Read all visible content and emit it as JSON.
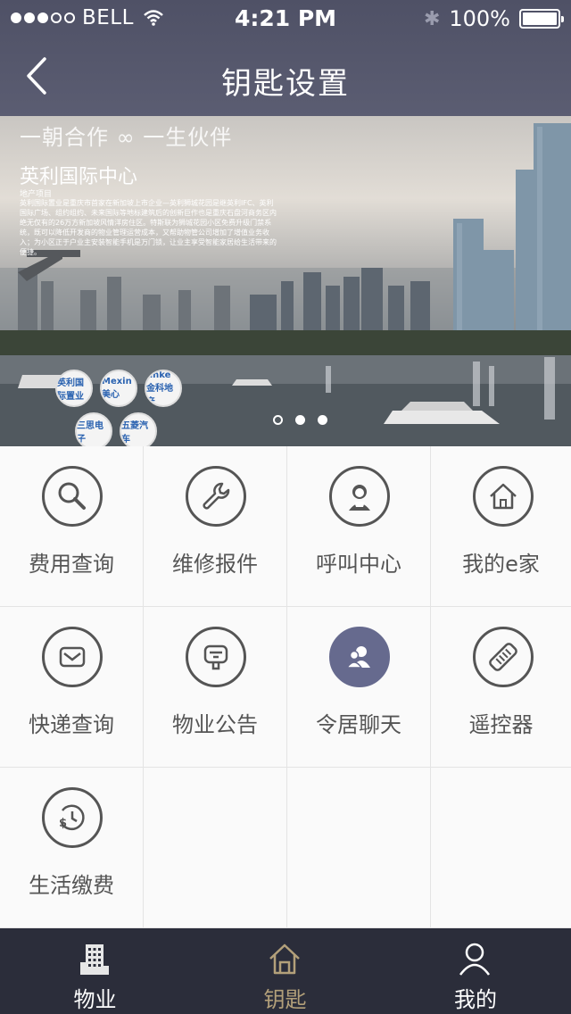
{
  "status_bar": {
    "carrier": "BELL",
    "time": "4:21 PM",
    "battery": "100%"
  },
  "nav": {
    "title": "钥匙设置"
  },
  "banner": {
    "slogan": "一朝合作 ∞ 一生伙伴",
    "title": "英利国际中心",
    "subtitle": "地产项目",
    "body": "英利国际置业是重庆市首家在新加坡上市企业—英利狮城花园是继英利IFC、英利国际广场、组约组约、未来国际等地标建筑后的创新巨作也是重庆石盘河商务区内绝无仅有的26万方新加坡风情洋房住区。特斯联为狮城花园小区免费升级门禁系统，既可以降低开发商的物业管理运营成本，又帮助物管公司增加了增值业务收入；为小区正于户业主安装智能手机是万门锁，让业主享受智能家居给生活带来的便捷。",
    "logos": [
      "英利国际置业",
      "Mexin 美心",
      "Jinke 金科地产",
      "三思电子",
      "五菱汽车"
    ],
    "pages": 3,
    "active_page": 1
  },
  "grid": {
    "items": [
      {
        "label": "费用查询",
        "icon": "magnifier-icon"
      },
      {
        "label": "维修报件",
        "icon": "wrench-icon"
      },
      {
        "label": "呼叫中心",
        "icon": "customer-service-icon"
      },
      {
        "label": "我的e家",
        "icon": "home-icon"
      },
      {
        "label": "快递查询",
        "icon": "envelope-icon"
      },
      {
        "label": "物业公告",
        "icon": "notice-icon"
      },
      {
        "label": "令居聊天",
        "icon": "chat-users-icon"
      },
      {
        "label": "遥控器",
        "icon": "remote-control-icon"
      },
      {
        "label": "生活缴费",
        "icon": "payment-clock-icon"
      }
    ]
  },
  "tabbar": {
    "tabs": [
      {
        "label": "物业",
        "icon": "building-icon"
      },
      {
        "label": "钥匙",
        "icon": "house-icon"
      },
      {
        "label": "我的",
        "icon": "user-icon"
      }
    ],
    "active": 1
  },
  "colors": {
    "nav_bg": "#5b5d72",
    "tabbar_bg": "#2b2d3a",
    "accent_active": "#b3a07a",
    "highlight_circle": "#666a8e"
  }
}
